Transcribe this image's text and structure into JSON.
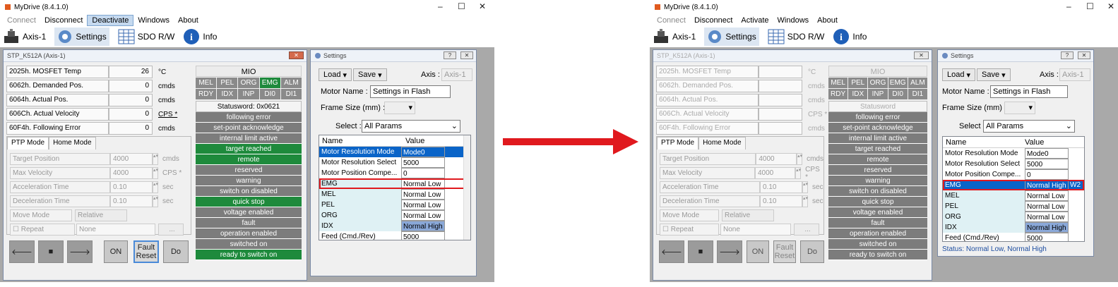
{
  "app": {
    "title": "MyDrive (8.4.1.0)",
    "minimize": "–",
    "maximize": "☐",
    "close": "✕"
  },
  "left": {
    "menu": [
      "Connect",
      "Disconnect",
      "Deactivate",
      "Windows",
      "About"
    ],
    "active_menu": 2
  },
  "right": {
    "menu": [
      "Connect",
      "Disconnect",
      "Activate",
      "Windows",
      "About"
    ]
  },
  "toolbar": {
    "axis": "Axis-1",
    "settings": "Settings",
    "sdo": "SDO R/W",
    "info": "Info"
  },
  "axis_window": {
    "title": "STP_K512A (Axis-1)",
    "close": "✕",
    "params": [
      {
        "name": "2025h. MOSFET Temp",
        "value": "26",
        "unit": "°C"
      },
      {
        "name": "6062h. Demanded Pos.",
        "value": "0",
        "unit": "cmds"
      },
      {
        "name": "6064h. Actual Pos.",
        "value": "0",
        "unit": "cmds"
      },
      {
        "name": "606Ch. Actual Velocity",
        "value": "0",
        "unit": "CPS *"
      },
      {
        "name": "60F4h. Following Error",
        "value": "0",
        "unit": "cmds"
      }
    ],
    "mio_title": "MIO",
    "mio": [
      {
        "label": "MEL",
        "on": false
      },
      {
        "label": "PEL",
        "on": false
      },
      {
        "label": "ORG",
        "on": false
      },
      {
        "label": "EMG",
        "on": true
      },
      {
        "label": "ALM",
        "on": false
      },
      {
        "label": "RDY",
        "on": false
      },
      {
        "label": "IDX",
        "on": false
      },
      {
        "label": "INP",
        "on": false
      },
      {
        "label": "DI0",
        "on": false
      },
      {
        "label": "DI1",
        "on": false
      }
    ],
    "statusword_left": "Statusword: 0x0621",
    "statusword_right": "Statusword",
    "statusbits": [
      {
        "label": "following error",
        "on_left": false
      },
      {
        "label": "set-point acknowledge",
        "on_left": false
      },
      {
        "label": "internal limit active",
        "on_left": false
      },
      {
        "label": "target reached",
        "on_left": true
      },
      {
        "label": "remote",
        "on_left": true
      },
      {
        "label": "reserved",
        "on_left": false
      },
      {
        "label": "warning",
        "on_left": false
      },
      {
        "label": "switch on disabled",
        "on_left": false
      },
      {
        "label": "quick stop",
        "on_left": true
      },
      {
        "label": "voltage enabled",
        "on_left": false
      },
      {
        "label": "fault",
        "on_left": false
      },
      {
        "label": "operation enabled",
        "on_left": false
      },
      {
        "label": "switched on",
        "on_left": false
      },
      {
        "label": "ready to switch on",
        "on_left": true
      }
    ],
    "tabs": [
      "PTP Mode",
      "Home Mode"
    ],
    "fields": [
      {
        "label": "Target Position",
        "value": "4000",
        "unit": "cmds"
      },
      {
        "label": "Max Velocity",
        "value": "4000",
        "unit": "CPS *"
      },
      {
        "label": "Acceleration Time",
        "value": "0.10",
        "unit": "sec"
      },
      {
        "label": "Deceleration Time",
        "value": "0.10",
        "unit": "sec"
      }
    ],
    "move_mode_label": "Move Mode",
    "move_mode_value": "Relative",
    "repeat_label": "Repeat",
    "repeat_value": "None",
    "repeat_btn": "...",
    "cmd": {
      "left": "🡐",
      "stop": "■",
      "right": "🡒",
      "on": "ON",
      "fault_reset_1": "Fault",
      "fault_reset_2": "Reset",
      "do": "Do"
    }
  },
  "settings": {
    "title": "Settings",
    "load": "Load",
    "save": "Save",
    "axis_label": "Axis :",
    "axis_value": "Axis-1",
    "motor_name_label": "Motor Name :",
    "motor_name_value": "Settings in Flash",
    "frame_size_label": "Frame Size (mm) :",
    "select_label": "Select :",
    "select_value": "All Params",
    "col_name": "Name",
    "col_value": "Value",
    "rows": [
      {
        "name": "Motor Resolution Mode",
        "value": "Mode0"
      },
      {
        "name": "Motor Resolution Select",
        "value": "5000"
      },
      {
        "name": "Motor Position Compe...",
        "value": "0"
      },
      {
        "name": "EMG",
        "value": "Normal Low"
      },
      {
        "name": "MEL",
        "value": "Normal Low"
      },
      {
        "name": "PEL",
        "value": "Normal Low"
      },
      {
        "name": "ORG",
        "value": "Normal Low"
      },
      {
        "name": "IDX",
        "value": "Normal High"
      },
      {
        "name": "Feed (Cmd./Rev)",
        "value": "5000"
      }
    ],
    "right_rows": [
      {
        "name": "Motor Resolution Mode",
        "value": "Mode0"
      },
      {
        "name": "Motor Resolution Select",
        "value": "5000"
      },
      {
        "name": "Motor Position Compe...",
        "value": "0"
      },
      {
        "name": "EMG",
        "value": "Normal High",
        "extra": "W2"
      },
      {
        "name": "MEL",
        "value": "Normal Low"
      },
      {
        "name": "PEL",
        "value": "Normal Low"
      },
      {
        "name": "ORG",
        "value": "Normal Low"
      },
      {
        "name": "IDX",
        "value": "Normal High"
      },
      {
        "name": "Feed (Cmd./Rev)",
        "value": "5000"
      }
    ],
    "status_text": "Status: Normal Low, Normal High"
  },
  "colors": {
    "green": "#1e8a3c",
    "highlight": "#0a64c8",
    "arrow": "#e0191e",
    "outline": "#e0191e"
  }
}
